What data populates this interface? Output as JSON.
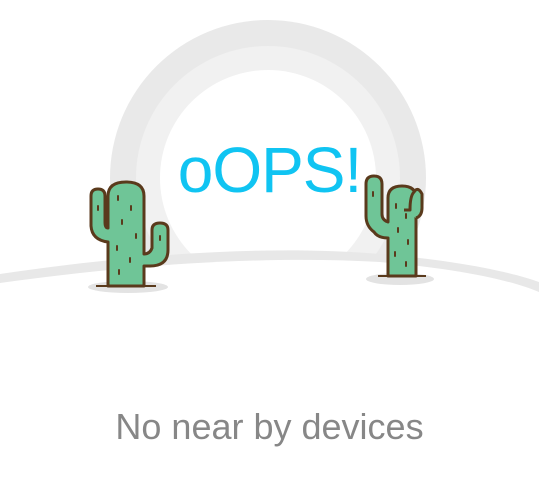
{
  "empty_state": {
    "title": "oOPS!",
    "message": "No near by devices",
    "title_color": "#10c4f2",
    "message_color": "#878787"
  },
  "illustration": {
    "icons": [
      "sun-ring-icon",
      "desert-ground-icon",
      "cactus-left-icon",
      "cactus-right-icon"
    ],
    "cactus_fill": "#6fc597",
    "cactus_outline": "#5a3a1c",
    "ring_color": "#e6e6e6"
  }
}
